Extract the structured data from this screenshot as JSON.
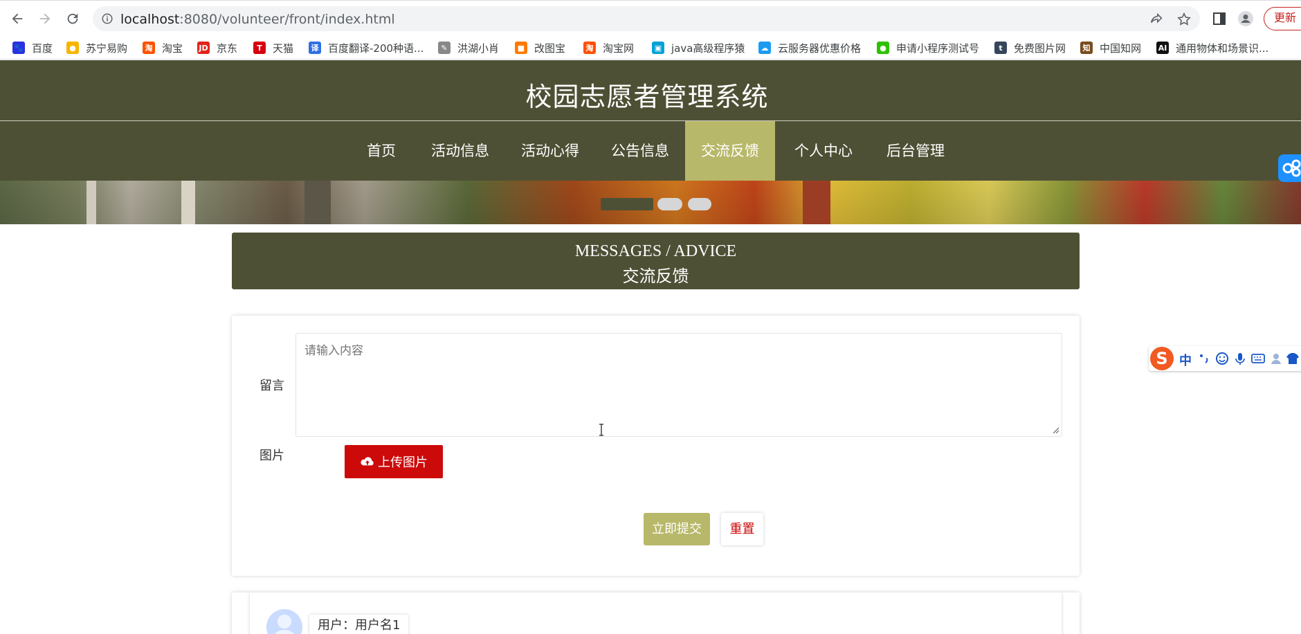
{
  "browser": {
    "url_host": "localhost",
    "url_path": ":8080/volunteer/front/index.html",
    "update_label": "更新",
    "icons": [
      "back-icon",
      "forward-icon",
      "reload-icon",
      "info-icon",
      "share-icon",
      "star-icon",
      "side-panel-icon",
      "profile-icon"
    ]
  },
  "bookmarks": [
    {
      "label": "百度",
      "color": "#2932e1",
      "glyph": "🐾"
    },
    {
      "label": "苏宁易购",
      "color": "#f7b500",
      "glyph": "●"
    },
    {
      "label": "淘宝",
      "color": "#ff5000",
      "glyph": "淘"
    },
    {
      "label": "京东",
      "color": "#e1251b",
      "glyph": "JD"
    },
    {
      "label": "天猫",
      "color": "#d6000f",
      "glyph": "T"
    },
    {
      "label": "百度翻译-200种语...",
      "color": "#2f6fe4",
      "glyph": "译"
    },
    {
      "label": "洪湖小肖",
      "color": "#888888",
      "glyph": "✎"
    },
    {
      "label": "改图宝",
      "color": "#ff7a00",
      "glyph": "■"
    },
    {
      "label": "淘宝网",
      "color": "#ff5000",
      "glyph": "淘"
    },
    {
      "label": "java高级程序猿",
      "color": "#00a1d6",
      "glyph": "▣"
    },
    {
      "label": "云服务器优惠价格",
      "color": "#1d9bf0",
      "glyph": "☁"
    },
    {
      "label": "申请小程序测试号",
      "color": "#2dc100",
      "glyph": "●"
    },
    {
      "label": "免费图片网",
      "color": "#35465c",
      "glyph": "t"
    },
    {
      "label": "中国知网",
      "color": "#7a4b1e",
      "glyph": "知"
    },
    {
      "label": "通用物体和场景识...",
      "color": "#111111",
      "glyph": "AI"
    }
  ],
  "site": {
    "title": "校园志愿者管理系统",
    "nav": [
      {
        "label": "首页",
        "active": false
      },
      {
        "label": "活动信息",
        "active": false
      },
      {
        "label": "活动心得",
        "active": false
      },
      {
        "label": "公告信息",
        "active": false
      },
      {
        "label": "交流反馈",
        "active": true
      },
      {
        "label": "个人中心",
        "active": false
      },
      {
        "label": "后台管理",
        "active": false
      }
    ],
    "carousel_active": 0
  },
  "section": {
    "title_en": "MESSAGES / ADVICE",
    "title_zh": "交流反馈"
  },
  "form": {
    "message_label": "留言",
    "message_placeholder": "请输入内容",
    "message_value": "",
    "image_label": "图片",
    "upload_label": "上传图片",
    "submit_label": "立即提交",
    "reset_label": "重置"
  },
  "messages": [
    {
      "user": "用户：用户名1"
    }
  ],
  "ime": {
    "logo": "S",
    "mode": "中"
  },
  "colors": {
    "header_bg": "#4e5035",
    "accent": "#b8b86a",
    "upload_red": "#cc0a0a"
  }
}
